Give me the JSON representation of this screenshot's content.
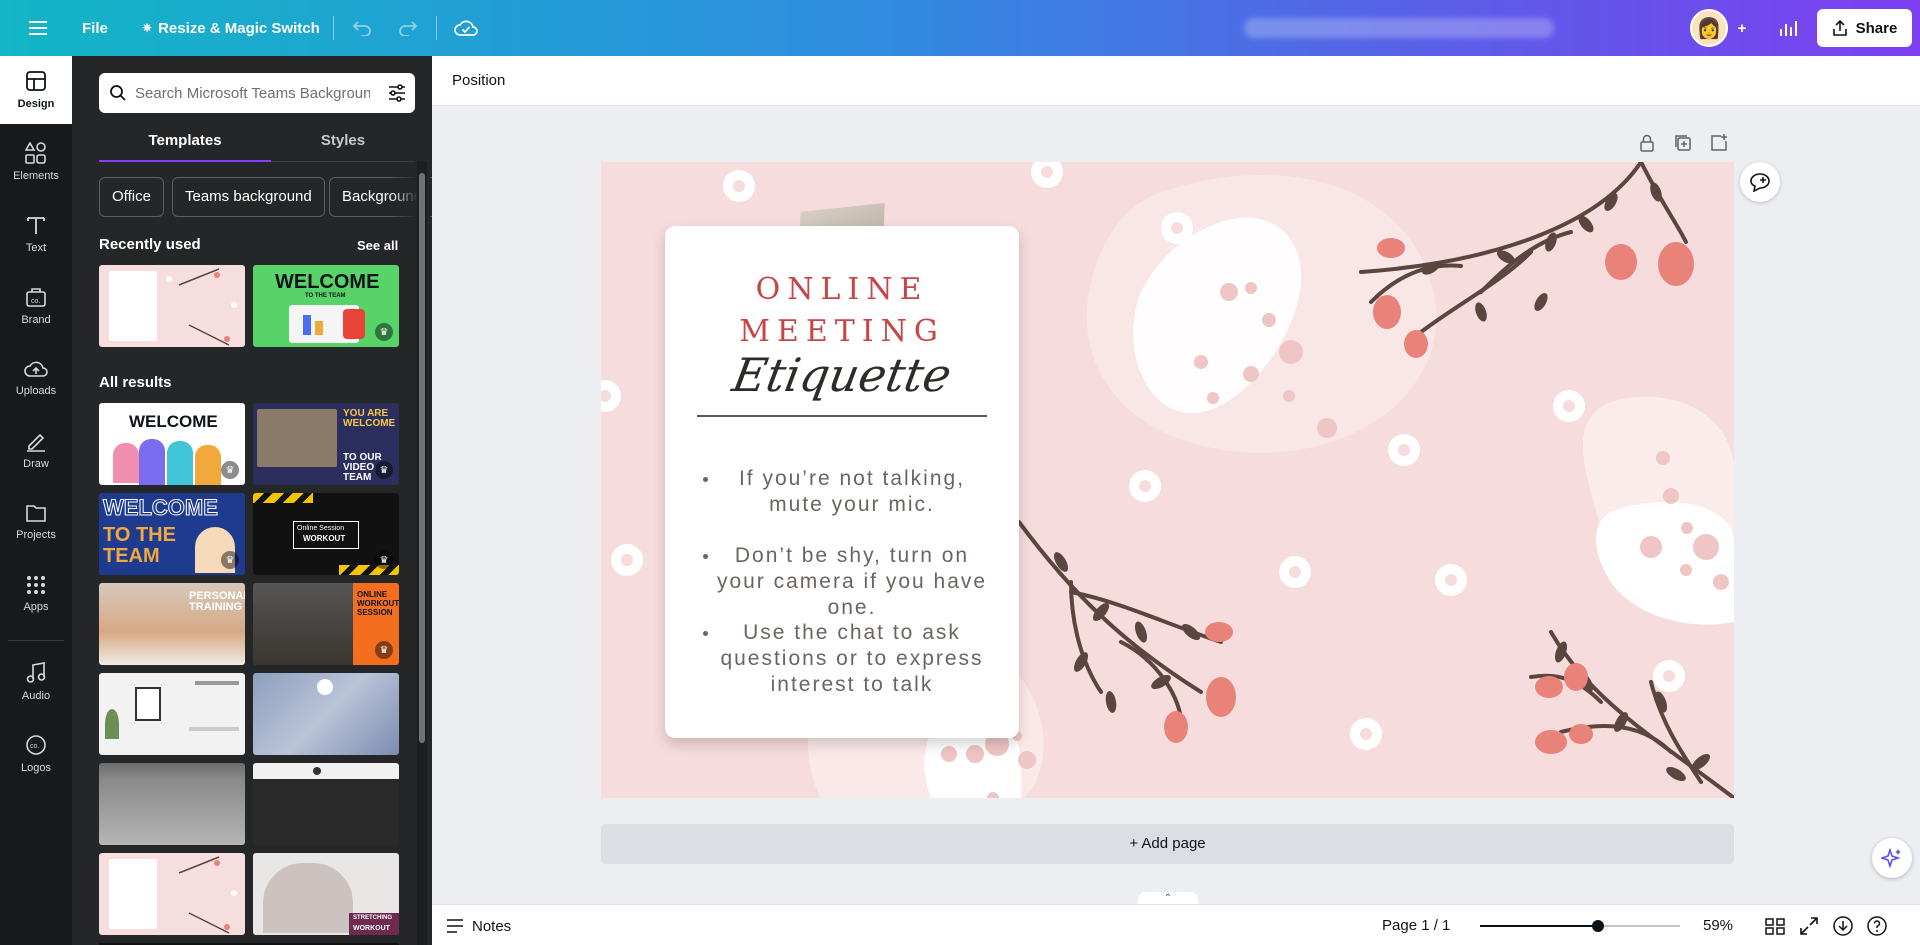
{
  "topbar": {
    "file_label": "File",
    "resize_label": "Resize & Magic Switch",
    "share_label": "Share"
  },
  "rail": {
    "items": [
      {
        "label": "Design",
        "icon": "design-icon"
      },
      {
        "label": "Elements",
        "icon": "elements-icon"
      },
      {
        "label": "Text",
        "icon": "text-icon"
      },
      {
        "label": "Brand",
        "icon": "brand-icon"
      },
      {
        "label": "Uploads",
        "icon": "uploads-icon"
      },
      {
        "label": "Draw",
        "icon": "draw-icon"
      },
      {
        "label": "Projects",
        "icon": "projects-icon"
      },
      {
        "label": "Apps",
        "icon": "apps-icon"
      },
      {
        "label": "Audio",
        "icon": "audio-icon"
      },
      {
        "label": "Logos",
        "icon": "logos-icon"
      }
    ]
  },
  "panel": {
    "search_placeholder": "Search Microsoft Teams Backgrounds",
    "tabs": {
      "templates": "Templates",
      "styles": "Styles"
    },
    "chips": [
      "Office",
      "Teams background",
      "Backgrounds"
    ],
    "recent_heading": "Recently used",
    "see_all": "See all",
    "all_heading": "All results",
    "thumbs": {
      "welcome_green_title": "WELCOME",
      "welcome_green_sub": "TO THE TEAM",
      "welcome_white_title": "WELCOME",
      "you_are_welcome": "YOU ARE WELCOME",
      "to_our_video": "TO OUR VIDEO TEAM",
      "welcome_outline": "WELCOME",
      "to_the_team": "TO THE TEAM",
      "online_session": "Online Session",
      "workout": "WORKOUT",
      "personal_training": "PERSONAL TRAINING",
      "online_workout": "ONLINE WORKOUT SESSION",
      "stretching": "STRETCHING",
      "workout2": "WORKOUT"
    }
  },
  "contextbar": {
    "position_label": "Position"
  },
  "design": {
    "title_line1": "ONLINE",
    "title_line2": "MEETING",
    "title_script": "Etiquette",
    "bullets": [
      "If you’re not talking, mute your mic.",
      "Don’t be shy, turn on your camera if you have one.",
      "Use the chat to ask questions or to express interest to talk"
    ],
    "colors": {
      "background": "#f6dcdc",
      "title": "#c74548",
      "branch": "#5b463f",
      "bud": "#e9837a"
    }
  },
  "add_page_label": "+ Add page",
  "bottombar": {
    "notes_label": "Notes",
    "page_label": "Page 1 / 1",
    "zoom_label": "59%",
    "zoom_level": 0.59
  },
  "colors": {
    "accent": "#8b3dff",
    "panel_bg": "#252627",
    "rail_bg": "#18191b"
  }
}
